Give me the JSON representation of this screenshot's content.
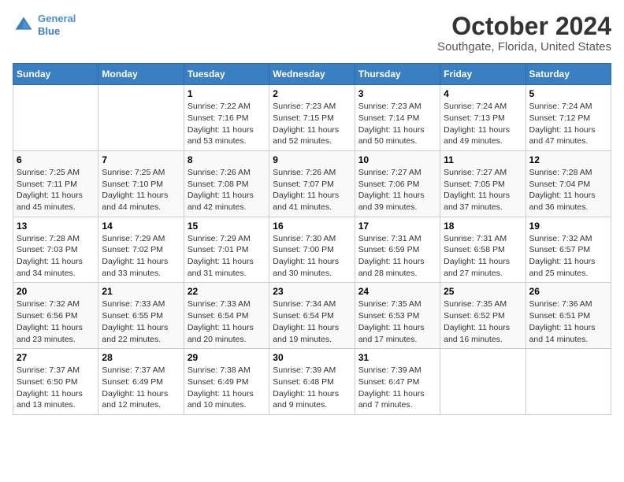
{
  "header": {
    "logo_line1": "General",
    "logo_line2": "Blue",
    "title": "October 2024",
    "subtitle": "Southgate, Florida, United States"
  },
  "weekdays": [
    "Sunday",
    "Monday",
    "Tuesday",
    "Wednesday",
    "Thursday",
    "Friday",
    "Saturday"
  ],
  "weeks": [
    [
      {
        "day": "",
        "info": ""
      },
      {
        "day": "",
        "info": ""
      },
      {
        "day": "1",
        "info": "Sunrise: 7:22 AM\nSunset: 7:16 PM\nDaylight: 11 hours and 53 minutes."
      },
      {
        "day": "2",
        "info": "Sunrise: 7:23 AM\nSunset: 7:15 PM\nDaylight: 11 hours and 52 minutes."
      },
      {
        "day": "3",
        "info": "Sunrise: 7:23 AM\nSunset: 7:14 PM\nDaylight: 11 hours and 50 minutes."
      },
      {
        "day": "4",
        "info": "Sunrise: 7:24 AM\nSunset: 7:13 PM\nDaylight: 11 hours and 49 minutes."
      },
      {
        "day": "5",
        "info": "Sunrise: 7:24 AM\nSunset: 7:12 PM\nDaylight: 11 hours and 47 minutes."
      }
    ],
    [
      {
        "day": "6",
        "info": "Sunrise: 7:25 AM\nSunset: 7:11 PM\nDaylight: 11 hours and 45 minutes."
      },
      {
        "day": "7",
        "info": "Sunrise: 7:25 AM\nSunset: 7:10 PM\nDaylight: 11 hours and 44 minutes."
      },
      {
        "day": "8",
        "info": "Sunrise: 7:26 AM\nSunset: 7:08 PM\nDaylight: 11 hours and 42 minutes."
      },
      {
        "day": "9",
        "info": "Sunrise: 7:26 AM\nSunset: 7:07 PM\nDaylight: 11 hours and 41 minutes."
      },
      {
        "day": "10",
        "info": "Sunrise: 7:27 AM\nSunset: 7:06 PM\nDaylight: 11 hours and 39 minutes."
      },
      {
        "day": "11",
        "info": "Sunrise: 7:27 AM\nSunset: 7:05 PM\nDaylight: 11 hours and 37 minutes."
      },
      {
        "day": "12",
        "info": "Sunrise: 7:28 AM\nSunset: 7:04 PM\nDaylight: 11 hours and 36 minutes."
      }
    ],
    [
      {
        "day": "13",
        "info": "Sunrise: 7:28 AM\nSunset: 7:03 PM\nDaylight: 11 hours and 34 minutes."
      },
      {
        "day": "14",
        "info": "Sunrise: 7:29 AM\nSunset: 7:02 PM\nDaylight: 11 hours and 33 minutes."
      },
      {
        "day": "15",
        "info": "Sunrise: 7:29 AM\nSunset: 7:01 PM\nDaylight: 11 hours and 31 minutes."
      },
      {
        "day": "16",
        "info": "Sunrise: 7:30 AM\nSunset: 7:00 PM\nDaylight: 11 hours and 30 minutes."
      },
      {
        "day": "17",
        "info": "Sunrise: 7:31 AM\nSunset: 6:59 PM\nDaylight: 11 hours and 28 minutes."
      },
      {
        "day": "18",
        "info": "Sunrise: 7:31 AM\nSunset: 6:58 PM\nDaylight: 11 hours and 27 minutes."
      },
      {
        "day": "19",
        "info": "Sunrise: 7:32 AM\nSunset: 6:57 PM\nDaylight: 11 hours and 25 minutes."
      }
    ],
    [
      {
        "day": "20",
        "info": "Sunrise: 7:32 AM\nSunset: 6:56 PM\nDaylight: 11 hours and 23 minutes."
      },
      {
        "day": "21",
        "info": "Sunrise: 7:33 AM\nSunset: 6:55 PM\nDaylight: 11 hours and 22 minutes."
      },
      {
        "day": "22",
        "info": "Sunrise: 7:33 AM\nSunset: 6:54 PM\nDaylight: 11 hours and 20 minutes."
      },
      {
        "day": "23",
        "info": "Sunrise: 7:34 AM\nSunset: 6:54 PM\nDaylight: 11 hours and 19 minutes."
      },
      {
        "day": "24",
        "info": "Sunrise: 7:35 AM\nSunset: 6:53 PM\nDaylight: 11 hours and 17 minutes."
      },
      {
        "day": "25",
        "info": "Sunrise: 7:35 AM\nSunset: 6:52 PM\nDaylight: 11 hours and 16 minutes."
      },
      {
        "day": "26",
        "info": "Sunrise: 7:36 AM\nSunset: 6:51 PM\nDaylight: 11 hours and 14 minutes."
      }
    ],
    [
      {
        "day": "27",
        "info": "Sunrise: 7:37 AM\nSunset: 6:50 PM\nDaylight: 11 hours and 13 minutes."
      },
      {
        "day": "28",
        "info": "Sunrise: 7:37 AM\nSunset: 6:49 PM\nDaylight: 11 hours and 12 minutes."
      },
      {
        "day": "29",
        "info": "Sunrise: 7:38 AM\nSunset: 6:49 PM\nDaylight: 11 hours and 10 minutes."
      },
      {
        "day": "30",
        "info": "Sunrise: 7:39 AM\nSunset: 6:48 PM\nDaylight: 11 hours and 9 minutes."
      },
      {
        "day": "31",
        "info": "Sunrise: 7:39 AM\nSunset: 6:47 PM\nDaylight: 11 hours and 7 minutes."
      },
      {
        "day": "",
        "info": ""
      },
      {
        "day": "",
        "info": ""
      }
    ]
  ]
}
